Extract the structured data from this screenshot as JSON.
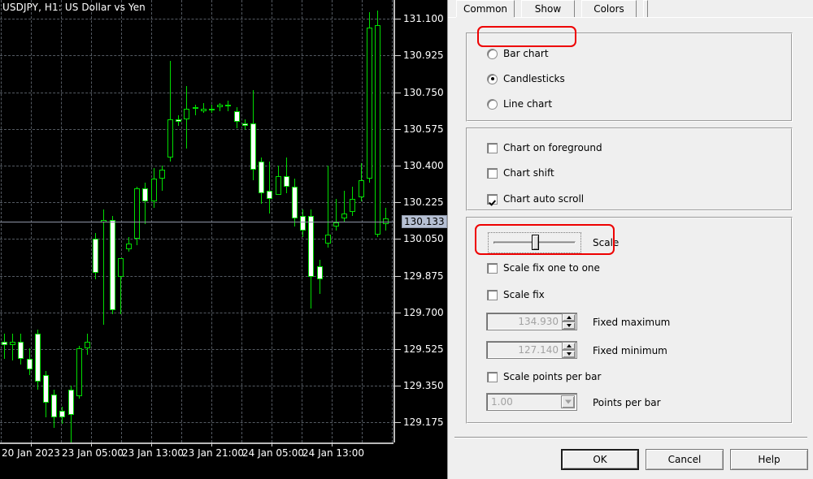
{
  "chart": {
    "title": "USDJPY, H1: US Dollar vs Yen",
    "last_price": "130.133",
    "price_ticks": [
      "131.100",
      "130.925",
      "130.750",
      "130.575",
      "130.400",
      "130.225",
      "130.050",
      "129.875",
      "129.700",
      "129.525",
      "129.350",
      "129.175"
    ],
    "time_ticks": [
      "20 Jan 2023",
      "23 Jan 05:00",
      "23 Jan 13:00",
      "23 Jan 21:00",
      "24 Jan 05:00",
      "24 Jan 13:00"
    ],
    "colors": {
      "background": "#000000",
      "grid": "#545a62",
      "bull": "#00dd00",
      "axis": "#b9b9b9",
      "last_price_badge": "#b6c0d4"
    }
  },
  "chart_data": {
    "type": "candlestick",
    "title": "USDJPY, H1: US Dollar vs Yen",
    "symbol": "USDJPY",
    "timeframe": "H1",
    "description": "US Dollar vs Yen",
    "xlabel": "",
    "ylabel": "",
    "ylim": [
      129.08,
      131.19
    ],
    "grid": true,
    "last_price": 130.133,
    "yticks": [
      131.1,
      130.925,
      130.75,
      130.575,
      130.4,
      130.225,
      130.05,
      129.875,
      129.7,
      129.525,
      129.35,
      129.175
    ],
    "xticks": [
      "20 Jan 2023",
      "23 Jan 05:00",
      "23 Jan 13:00",
      "23 Jan 21:00",
      "24 Jan 05:00",
      "24 Jan 13:00"
    ],
    "candles": [
      {
        "o": 129.56,
        "h": 129.6,
        "l": 129.48,
        "c": 129.545
      },
      {
        "o": 129.545,
        "h": 129.6,
        "l": 129.47,
        "c": 129.56
      },
      {
        "o": 129.56,
        "h": 129.6,
        "l": 129.45,
        "c": 129.48
      },
      {
        "o": 129.48,
        "h": 129.53,
        "l": 129.4,
        "c": 129.43
      },
      {
        "o": 129.6,
        "h": 129.62,
        "l": 129.33,
        "c": 129.37
      },
      {
        "o": 129.4,
        "h": 129.42,
        "l": 129.2,
        "c": 129.27
      },
      {
        "o": 129.31,
        "h": 129.33,
        "l": 129.15,
        "c": 129.2
      },
      {
        "o": 129.23,
        "h": 129.25,
        "l": 129.17,
        "c": 129.2
      },
      {
        "o": 129.33,
        "h": 129.35,
        "l": 129.08,
        "c": 129.21
      },
      {
        "o": 129.3,
        "h": 129.54,
        "l": 129.29,
        "c": 129.53
      },
      {
        "o": 129.53,
        "h": 129.6,
        "l": 129.5,
        "c": 129.56
      },
      {
        "o": 130.05,
        "h": 130.08,
        "l": 129.86,
        "c": 129.89
      },
      {
        "o": 130.13,
        "h": 130.19,
        "l": 129.64,
        "c": 130.14
      },
      {
        "o": 130.14,
        "h": 130.16,
        "l": 129.69,
        "c": 129.71
      },
      {
        "o": 129.87,
        "h": 129.9,
        "l": 129.69,
        "c": 129.96
      },
      {
        "o": 130.0,
        "h": 130.06,
        "l": 129.99,
        "c": 130.03
      },
      {
        "o": 130.05,
        "h": 130.3,
        "l": 130.02,
        "c": 130.29
      },
      {
        "o": 130.29,
        "h": 130.32,
        "l": 130.12,
        "c": 130.23
      },
      {
        "o": 130.23,
        "h": 130.39,
        "l": 130.2,
        "c": 130.34
      },
      {
        "o": 130.34,
        "h": 130.4,
        "l": 130.28,
        "c": 130.38
      },
      {
        "o": 130.44,
        "h": 130.9,
        "l": 130.42,
        "c": 130.62
      },
      {
        "o": 130.62,
        "h": 130.64,
        "l": 130.59,
        "c": 130.61
      },
      {
        "o": 130.62,
        "h": 130.78,
        "l": 130.48,
        "c": 130.67
      },
      {
        "o": 130.67,
        "h": 130.69,
        "l": 130.64,
        "c": 130.68
      },
      {
        "o": 130.66,
        "h": 130.7,
        "l": 130.65,
        "c": 130.67
      },
      {
        "o": 130.67,
        "h": 130.69,
        "l": 130.65,
        "c": 130.67
      },
      {
        "o": 130.68,
        "h": 130.7,
        "l": 130.66,
        "c": 130.69
      },
      {
        "o": 130.69,
        "h": 130.71,
        "l": 130.66,
        "c": 130.69
      },
      {
        "o": 130.66,
        "h": 130.68,
        "l": 130.58,
        "c": 130.61
      },
      {
        "o": 130.6,
        "h": 130.62,
        "l": 130.57,
        "c": 130.59
      },
      {
        "o": 130.6,
        "h": 130.76,
        "l": 130.33,
        "c": 130.38
      },
      {
        "o": 130.42,
        "h": 130.44,
        "l": 130.22,
        "c": 130.27
      },
      {
        "o": 130.28,
        "h": 130.42,
        "l": 130.17,
        "c": 130.24
      },
      {
        "o": 130.26,
        "h": 130.4,
        "l": 130.34,
        "c": 130.35
      },
      {
        "o": 130.35,
        "h": 130.44,
        "l": 130.27,
        "c": 130.3
      },
      {
        "o": 130.3,
        "h": 130.34,
        "l": 130.11,
        "c": 130.15
      },
      {
        "o": 130.16,
        "h": 130.19,
        "l": 130.06,
        "c": 130.09
      },
      {
        "o": 130.16,
        "h": 130.19,
        "l": 129.72,
        "c": 129.87
      },
      {
        "o": 129.92,
        "h": 129.95,
        "l": 129.79,
        "c": 129.86
      },
      {
        "o": 130.03,
        "h": 130.4,
        "l": 130.01,
        "c": 130.07
      },
      {
        "o": 130.11,
        "h": 130.24,
        "l": 130.09,
        "c": 130.13
      },
      {
        "o": 130.15,
        "h": 130.28,
        "l": 130.13,
        "c": 130.17
      },
      {
        "o": 130.18,
        "h": 130.3,
        "l": 130.16,
        "c": 130.24
      },
      {
        "o": 130.25,
        "h": 130.41,
        "l": 130.23,
        "c": 130.33
      },
      {
        "o": 130.34,
        "h": 131.13,
        "l": 130.32,
        "c": 131.06
      },
      {
        "o": 130.07,
        "h": 131.14,
        "l": 130.06,
        "c": 131.07
      },
      {
        "o": 130.12,
        "h": 130.2,
        "l": 130.09,
        "c": 130.15
      }
    ]
  },
  "dialog": {
    "tabs": [
      {
        "label": "Common",
        "selected": true
      },
      {
        "label": "Show",
        "selected": false
      },
      {
        "label": "Colors",
        "selected": false
      }
    ],
    "chart_type": {
      "options": [
        {
          "label": "Bar chart",
          "selected": false
        },
        {
          "label": "Candlesticks",
          "selected": true
        },
        {
          "label": "Line chart",
          "selected": false
        }
      ]
    },
    "display_options": [
      {
        "label": "Chart on foreground",
        "checked": false
      },
      {
        "label": "Chart shift",
        "checked": false
      },
      {
        "label": "Chart auto scroll",
        "checked": true
      }
    ],
    "scale": {
      "slider_label": "Scale",
      "slider_position_percent": 50,
      "scale_fix_one_to_one": {
        "label": "Scale fix one to one",
        "checked": false
      },
      "scale_fix": {
        "label": "Scale fix",
        "checked": false
      },
      "fixed_maximum": {
        "label": "Fixed maximum",
        "value": "134.930"
      },
      "fixed_minimum": {
        "label": "Fixed minimum",
        "value": "127.140"
      },
      "scale_points_per_bar": {
        "label": "Scale points per bar",
        "checked": false
      },
      "points_per_bar": {
        "label": "Points per bar",
        "value": "1.00"
      }
    },
    "buttons": [
      {
        "label": "OK",
        "default": true
      },
      {
        "label": "Cancel",
        "default": false
      },
      {
        "label": "Help",
        "default": false
      }
    ],
    "highlight_color": "#ee0000"
  }
}
